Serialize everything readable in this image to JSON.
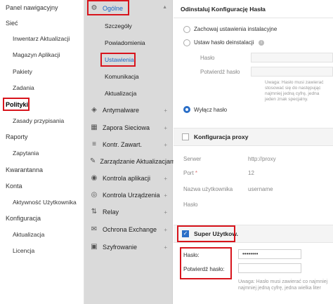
{
  "left_nav": {
    "items": [
      {
        "label": "Panel nawigacyjny"
      },
      {
        "label": "Sieć"
      },
      {
        "label": "Inwentarz Aktualizacji"
      },
      {
        "label": "Magazyn Aplikacji"
      },
      {
        "label": "Pakiety"
      },
      {
        "label": "Zadania"
      },
      {
        "label": "Polityki"
      },
      {
        "label": "Zasady przypisania"
      },
      {
        "label": "Raporty"
      },
      {
        "label": "Zapytania"
      },
      {
        "label": "Kwarantanna"
      },
      {
        "label": "Konta"
      },
      {
        "label": "Aktywność Użytkownika"
      },
      {
        "label": "Konfiguracja"
      },
      {
        "label": "Aktualizacja"
      },
      {
        "label": "Licencja"
      }
    ]
  },
  "mid_nav": {
    "general": {
      "label": "Ogólne",
      "subitems": [
        {
          "label": "Szczegóły"
        },
        {
          "label": "Powiadomienia"
        },
        {
          "label": "Ustawienia"
        },
        {
          "label": "Komunikacja"
        },
        {
          "label": "Aktualizacja"
        }
      ]
    },
    "sections": [
      {
        "label": "Antymalware"
      },
      {
        "label": "Zapora Sieciowa"
      },
      {
        "label": "Kontr. Zawart."
      },
      {
        "label": "Zarządzanie Aktualizacjami"
      },
      {
        "label": "Kontrola aplikacji"
      },
      {
        "label": "Kontrola Urządzenia"
      },
      {
        "label": "Relay"
      },
      {
        "label": "Ochrona Exchange"
      },
      {
        "label": "Szyfrowanie"
      }
    ]
  },
  "content": {
    "uninstall": {
      "title": "Odinstaluj Konfigurację Hasła",
      "opt_keep": "Zachowaj ustawienia instalacyjne",
      "opt_set": "Ustaw hasło deinstalacji",
      "password_label": "Hasło",
      "confirm_label": "Potwierdź hasło",
      "help_lines": [
        "Uwaga: Hasło musi zawierać",
        "stosować się do następując",
        "najmniej jedną cyfrę, jedna",
        "jeden znak specjalny."
      ],
      "opt_disable": "Wyłącz hasło"
    },
    "proxy": {
      "title": "Konfiguracja proxy",
      "server_label": "Serwer",
      "server_value": "http://proxy",
      "port_label": "Port",
      "port_value": "12",
      "user_label": "Nazwa użytkownika",
      "user_value": "username",
      "password_label": "Hasło"
    },
    "superuser": {
      "title": "Super Użytkow.",
      "password_label": "Hasło:",
      "password_value": "••••••••",
      "confirm_label": "Potwierdź hasło:",
      "help_lines": [
        "Uwaga: Hasło musi zawierać co najmniej",
        "najmniej jedną cyfrę, jedna wielka liter"
      ]
    }
  },
  "colors": {
    "accent": "#2a6ec7",
    "highlight": "#d8141c",
    "selected_text": "#1a66c4",
    "mid_bg": "#dadada"
  }
}
